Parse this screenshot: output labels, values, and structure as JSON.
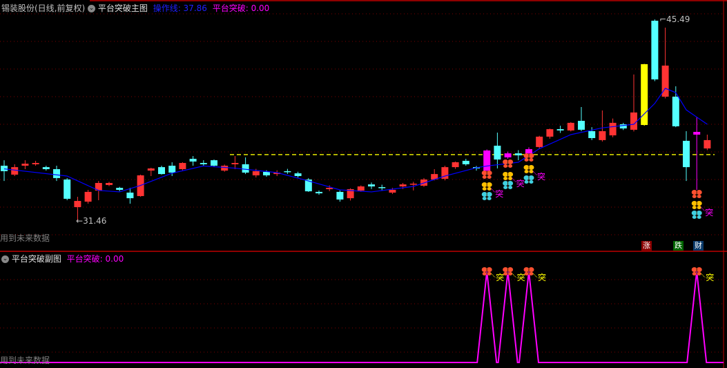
{
  "main": {
    "stock": "锡装股份(日线,前复权)",
    "indicator": "平台突破主图",
    "line_label": "操作线: 37.86",
    "break_label": "平台突破: 0.00",
    "future_warning": "用到未来数据",
    "high_label": "45.49",
    "low_label": "31.46",
    "platform_level": 36.09,
    "breakout_char": "突",
    "tags": [
      {
        "text": "涨",
        "color": "#8b0000"
      },
      {
        "text": "跌",
        "color": "#006400"
      },
      {
        "text": "财",
        "color": "#0a3a6a"
      }
    ]
  },
  "sub": {
    "indicator": "平台突破副图",
    "break_label": "平台突破: 0.00",
    "future_warning": "用到未来数据",
    "breakout_char": "突"
  },
  "colors": {
    "up": "#ff3333",
    "down": "#54ffff",
    "special": "#ff00ff",
    "yellow": "#ffff00",
    "ma": "#0000ff",
    "signal": "#ff00ff"
  },
  "chart_data": {
    "type": "candlestick",
    "candles": [
      [
        35.32,
        34.94,
        35.7,
        34.26
      ],
      [
        34.7,
        35.22,
        35.42,
        34.6
      ],
      [
        35.32,
        35.46,
        35.7,
        35.08
      ],
      [
        35.42,
        35.51,
        35.66,
        35.32
      ],
      [
        35.22,
        35.08,
        35.32,
        34.98
      ],
      [
        35.08,
        34.46,
        35.32,
        34.26
      ],
      [
        34.36,
        33.02,
        34.46,
        32.92
      ],
      [
        32.44,
        32.87,
        33.16,
        31.46
      ],
      [
        32.82,
        33.5,
        33.64,
        32.68
      ],
      [
        33.59,
        34.12,
        34.26,
        32.92
      ],
      [
        33.98,
        34.12,
        34.2,
        33.9
      ],
      [
        33.78,
        33.64,
        33.85,
        33.55
      ],
      [
        33.45,
        33.06,
        33.78,
        32.68
      ],
      [
        33.21,
        34.65,
        34.7,
        33.16
      ],
      [
        34.98,
        35.13,
        35.18,
        34.6
      ],
      [
        35.22,
        34.74,
        35.32,
        34.7
      ],
      [
        35.32,
        34.84,
        35.56,
        34.6
      ],
      [
        35.08,
        35.51,
        35.56,
        35.0
      ],
      [
        35.8,
        35.61,
        35.99,
        35.32
      ],
      [
        35.51,
        35.42,
        35.7,
        35.3
      ],
      [
        35.7,
        35.32,
        35.75,
        35.22
      ],
      [
        34.98,
        35.32,
        35.4,
        34.9
      ],
      [
        35.42,
        35.51,
        35.99,
        35.08
      ],
      [
        35.42,
        34.84,
        35.9,
        34.74
      ],
      [
        34.65,
        34.94,
        35.1,
        34.5
      ],
      [
        34.89,
        34.65,
        35.0,
        34.55
      ],
      [
        34.74,
        34.84,
        35.0,
        34.6
      ],
      [
        34.94,
        34.89,
        35.1,
        34.75
      ],
      [
        34.79,
        34.6,
        34.9,
        34.5
      ],
      [
        34.36,
        33.54,
        34.46,
        33.5
      ],
      [
        33.5,
        33.4,
        33.6,
        33.3
      ],
      [
        33.69,
        33.78,
        33.95,
        33.55
      ],
      [
        33.5,
        32.97,
        33.6,
        32.82
      ],
      [
        33.06,
        33.69,
        33.75,
        32.9
      ],
      [
        33.59,
        33.88,
        33.95,
        33.5
      ],
      [
        34.02,
        33.88,
        34.15,
        33.7
      ],
      [
        33.83,
        33.78,
        34.0,
        33.6
      ],
      [
        33.45,
        33.64,
        33.78,
        33.35
      ],
      [
        33.88,
        34.02,
        34.12,
        33.7
      ],
      [
        34.02,
        34.07,
        34.2,
        33.6
      ],
      [
        33.93,
        34.36,
        34.46,
        33.85
      ],
      [
        34.36,
        34.74,
        35.08,
        34.3
      ],
      [
        34.41,
        35.22,
        35.32,
        34.3
      ],
      [
        35.22,
        35.56,
        35.61,
        35.1
      ],
      [
        35.66,
        35.42,
        35.8,
        35.32
      ],
      [
        35.22,
        35.13,
        35.3,
        34.98
      ],
      [
        34.98,
        36.38,
        36.45,
        34.9
      ],
      [
        36.71,
        35.75,
        37.62,
        35.13
      ],
      [
        35.9,
        36.18,
        36.3,
        35.8
      ],
      [
        36.18,
        36.04,
        36.4,
        35.7
      ],
      [
        36.18,
        36.47,
        36.6,
        36.1
      ],
      [
        36.62,
        37.34,
        37.4,
        36.5
      ],
      [
        37.34,
        37.86,
        37.9,
        37.2
      ],
      [
        37.86,
        37.77,
        38.1,
        37.6
      ],
      [
        37.77,
        38.3,
        38.35,
        37.7
      ],
      [
        38.44,
        37.82,
        39.4,
        37.72
      ],
      [
        37.72,
        37.24,
        38.0,
        37.1
      ],
      [
        37.1,
        37.72,
        39.16,
        37.0
      ],
      [
        37.43,
        38.3,
        38.6,
        37.3
      ],
      [
        38.2,
        37.91,
        38.3,
        37.8
      ],
      [
        37.82,
        39.02,
        41.66,
        37.7
      ],
      [
        38.15,
        42.38,
        42.4,
        38.1
      ],
      [
        45.4,
        41.32,
        45.49,
        41.2
      ],
      [
        40.12,
        42.28,
        44.92,
        40.0
      ],
      [
        40.12,
        38.06,
        40.84,
        38.0
      ],
      [
        37.05,
        35.22,
        37.72,
        34.26
      ],
      [
        37.48,
        37.67,
        38.68,
        33.64
      ],
      [
        36.52,
        37.1,
        37.48,
        36.4
      ]
    ],
    "special_candles": {
      "46": "special",
      "48": "special",
      "50": "special",
      "61": "yellow",
      "66": "special"
    },
    "ma": [
      [
        0,
        35.1
      ],
      [
        6,
        34.6
      ],
      [
        9,
        33.6
      ],
      [
        11,
        33.5
      ],
      [
        13,
        33.95
      ],
      [
        16,
        34.8
      ],
      [
        19,
        35.3
      ],
      [
        22,
        35.15
      ],
      [
        26,
        34.84
      ],
      [
        29,
        34.26
      ],
      [
        32,
        33.64
      ],
      [
        35,
        33.5
      ],
      [
        39,
        33.88
      ],
      [
        42,
        34.6
      ],
      [
        45,
        35.18
      ],
      [
        46,
        35.3
      ],
      [
        49,
        35.56
      ],
      [
        51,
        36.5
      ],
      [
        54,
        37.48
      ],
      [
        57,
        37.95
      ],
      [
        60,
        38.2
      ],
      [
        62,
        39.65
      ],
      [
        63,
        40.7
      ],
      [
        64,
        40.4
      ],
      [
        65,
        39.2
      ],
      [
        67,
        38.2
      ]
    ],
    "breakout_indexes": [
      46,
      48,
      50,
      66
    ],
    "price_range": [
      31.46,
      45.49
    ],
    "sub_signal": {
      "indexes": [
        46,
        48,
        50,
        66
      ],
      "range": [
        0,
        1
      ]
    }
  }
}
